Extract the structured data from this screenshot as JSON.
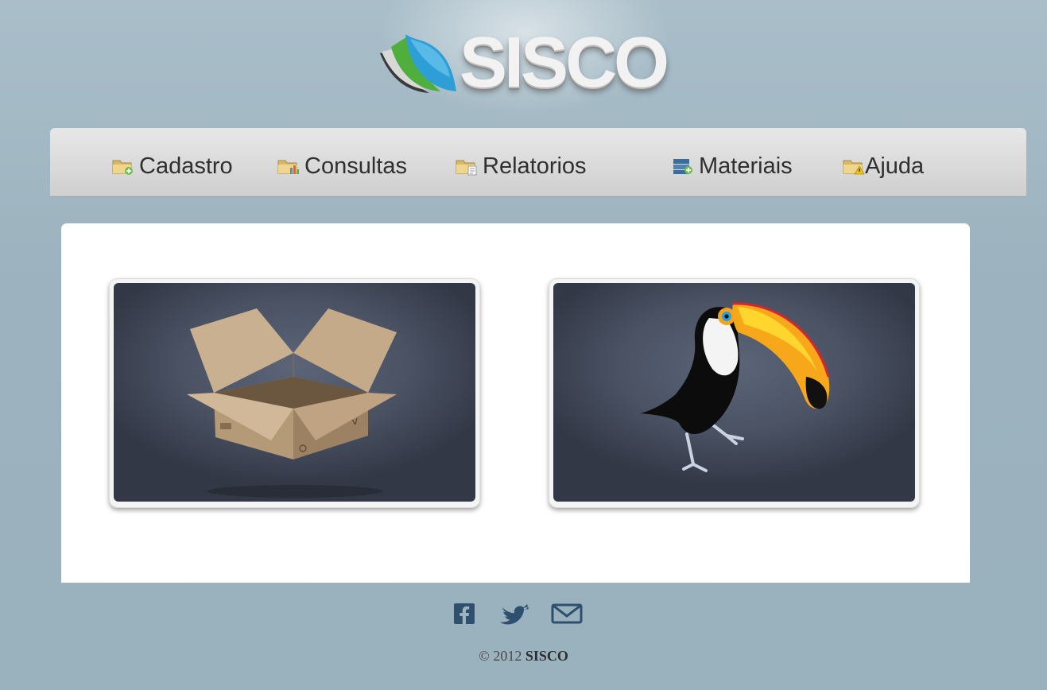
{
  "header": {
    "logo_text": "SISCO"
  },
  "nav": {
    "items": [
      {
        "label": "Cadastro",
        "icon": "folder-add-icon"
      },
      {
        "label": "Consultas",
        "icon": "folder-chart-icon"
      },
      {
        "label": "Relatorios",
        "icon": "folder-document-icon"
      },
      {
        "label": "Materiais",
        "icon": "materials-add-icon"
      },
      {
        "label": "Ajuda",
        "icon": "folder-warning-icon"
      }
    ]
  },
  "main": {
    "cards": [
      {
        "image": "cardboard-box-image"
      },
      {
        "image": "toucan-image"
      }
    ]
  },
  "footer": {
    "social": [
      "facebook-icon",
      "twitter-icon",
      "email-icon"
    ],
    "copyright_prefix": "© 2012",
    "copyright_brand": "SISCO"
  },
  "colors": {
    "background": "#9db4c0",
    "navbar": "#dadada",
    "card_background": "#4a5264"
  }
}
